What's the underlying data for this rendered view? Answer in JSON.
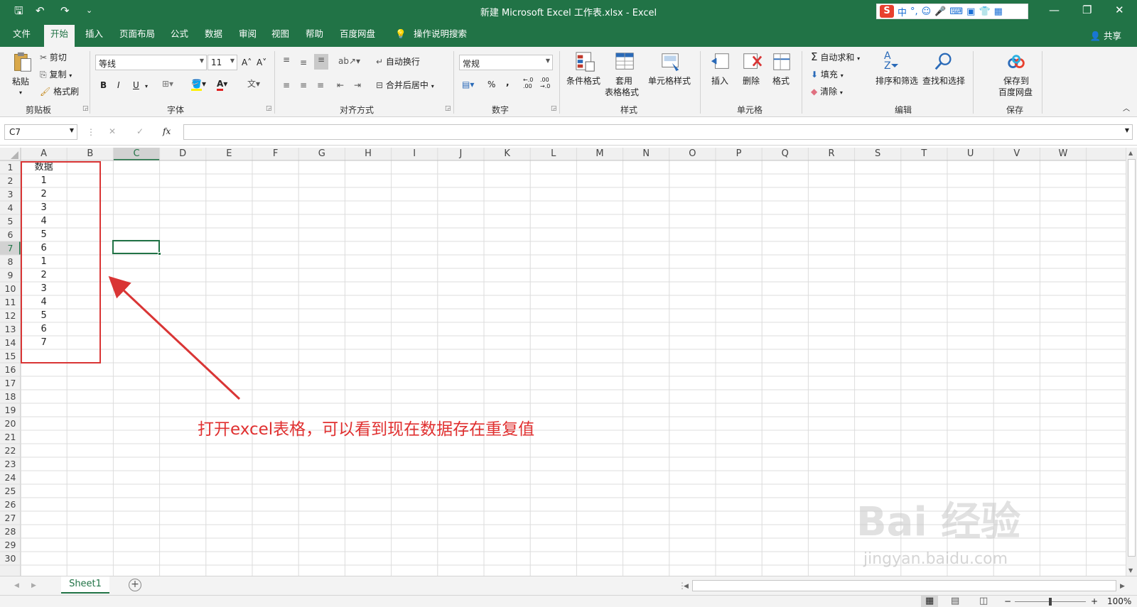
{
  "window": {
    "title": "新建 Microsoft Excel 工作表.xlsx  -  Excel",
    "minimize_icon": "—",
    "restore_icon": "❐",
    "close_icon": "✕"
  },
  "quick_access": {
    "save_icon": "🖫",
    "undo_icon": "↶",
    "redo_icon": "↷",
    "customize_icon": "⌄"
  },
  "ime_toolbar": {
    "logo": "S",
    "lang": "中",
    "punct": "°,",
    "items": [
      "☺",
      "🎤",
      "⌨",
      "▣",
      "👕",
      "▦"
    ]
  },
  "menu_tabs": [
    "文件",
    "开始",
    "插入",
    "页面布局",
    "公式",
    "数据",
    "审阅",
    "视图",
    "帮助",
    "百度网盘"
  ],
  "active_tab": "开始",
  "tell_me": "操作说明搜索",
  "share_label": "共享",
  "ribbon": {
    "clipboard": {
      "paste": "粘贴",
      "cut": "剪切",
      "copy": "复制",
      "format_painter": "格式刷",
      "group": "剪贴板"
    },
    "font": {
      "name": "等线",
      "size": "11",
      "grow": "A˄",
      "shrink": "A˅",
      "bold": "B",
      "italic": "I",
      "underline": "U",
      "group": "字体",
      "phonetic": "文"
    },
    "alignment": {
      "wrap": "自动换行",
      "merge": "合并后居中",
      "group": "对齐方式"
    },
    "number": {
      "format": "常规",
      "percent": "%",
      "comma": ",",
      "inc_decimal": "←.0 .00",
      "dec_decimal": ".00 →.0",
      "group": "数字"
    },
    "styles": {
      "conditional": "条件格式",
      "table1": "套用",
      "table2": "表格格式",
      "cell_styles": "单元格样式",
      "group": "样式"
    },
    "cells": {
      "insert": "插入",
      "delete": "删除",
      "format": "格式",
      "group": "单元格"
    },
    "editing": {
      "autosum": "自动求和",
      "fill": "填充",
      "clear": "清除",
      "sort": "排序和筛选",
      "find": "查找和选择",
      "group": "编辑"
    },
    "save": {
      "line1": "保存到",
      "line2": "百度网盘",
      "group": "保存"
    }
  },
  "formula_bar": {
    "name_box": "C7",
    "cancel": "✕",
    "enter": "✓",
    "fx": "fx",
    "value": ""
  },
  "columns": [
    "A",
    "B",
    "C",
    "D",
    "E",
    "F",
    "G",
    "H",
    "I",
    "J",
    "K",
    "L",
    "M",
    "N",
    "O",
    "P",
    "Q",
    "R",
    "S",
    "T",
    "U",
    "V",
    "W"
  ],
  "rows": [
    "1",
    "2",
    "3",
    "4",
    "5",
    "6",
    "7",
    "8",
    "9",
    "10",
    "11",
    "12",
    "13",
    "14",
    "15",
    "16",
    "17",
    "18",
    "19",
    "20",
    "21",
    "22",
    "23",
    "24",
    "25",
    "26",
    "27",
    "28",
    "29",
    "30"
  ],
  "selected_cell": "C7",
  "cells_A": [
    "数据",
    "1",
    "2",
    "3",
    "4",
    "5",
    "6",
    "1",
    "2",
    "3",
    "4",
    "5",
    "6",
    "7"
  ],
  "annotation": "打开excel表格，可以看到现在数据存在重复值",
  "watermark": {
    "brand": "Bai 经验",
    "url": "jingyan.baidu.com"
  },
  "sheet_tabs": [
    "Sheet1"
  ],
  "add_sheet": "+",
  "zoom": "100%",
  "colors": {
    "excel_green": "#217346",
    "annotation_red": "#e03030"
  }
}
